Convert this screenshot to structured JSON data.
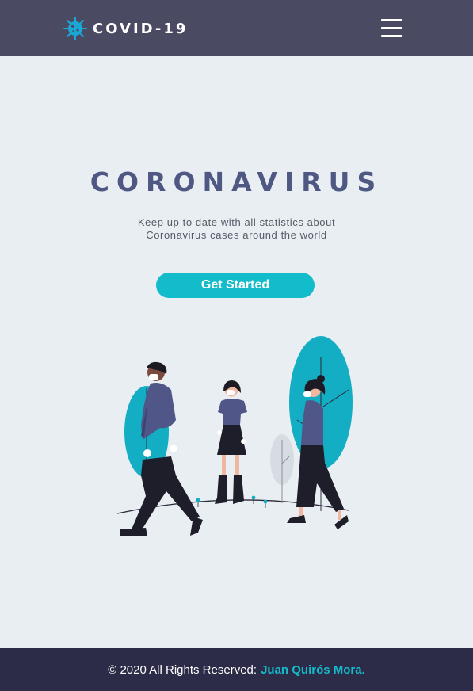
{
  "header": {
    "brand": "COVID-19",
    "brand_icon": "virus-icon",
    "menu_icon": "hamburger-menu-icon",
    "background": "#4a4a62"
  },
  "hero": {
    "title": "CORONAVIRUS",
    "subtitle_line1": "Keep up to date with all statistics about",
    "subtitle_line2": "Coronavirus cases around the world",
    "cta_label": "Get Started",
    "illustration": "people-walking-with-masks-illustration"
  },
  "footer": {
    "text": "© 2020 All Rights Reserved:",
    "author": "Juan Quirós Mora."
  },
  "colors": {
    "accent": "#13bccb",
    "title": "#4f5883",
    "page_background": "#e9eef3",
    "footer_background": "#2c2c48"
  }
}
